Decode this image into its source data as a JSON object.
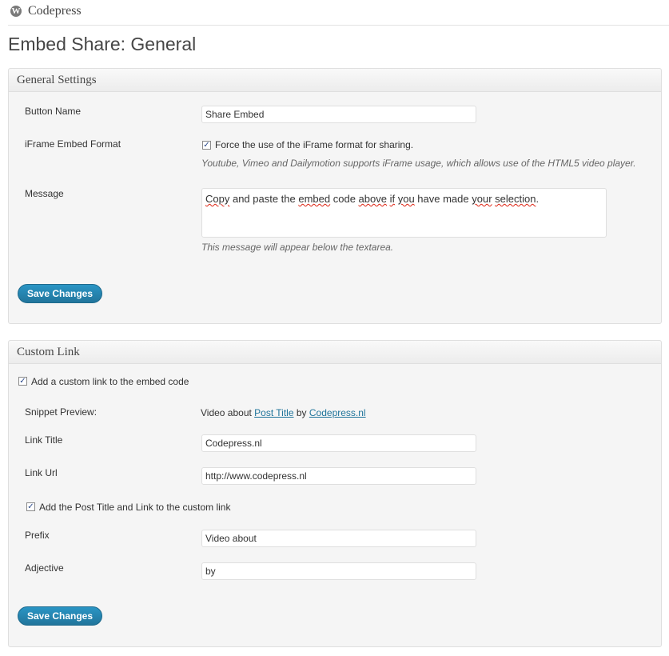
{
  "site": {
    "name": "Codepress",
    "logo_letter": "W"
  },
  "page": {
    "title": "Embed Share: General"
  },
  "general_settings": {
    "title": "General Settings",
    "button_name_label": "Button Name",
    "button_name_value": "Share Embed",
    "iframe_label": "iFrame Embed Format",
    "iframe_checkbox_label": "Force the use of the iFrame format for sharing.",
    "iframe_checked": true,
    "iframe_description": "Youtube, Vimeo and Dailymotion supports iFrame usage, which allows use of the HTML5 video player.",
    "message_label": "Message",
    "message_value_parts": [
      "Copy",
      " and paste the ",
      "embed",
      " code ",
      "above",
      " ",
      "if",
      " ",
      "you",
      " have made ",
      "your",
      " ",
      "selection",
      "."
    ],
    "message_description": "This message will appear below the textarea.",
    "save_label": "Save Changes"
  },
  "custom_link": {
    "title": "Custom Link",
    "add_link_label": "Add a custom link to the embed code",
    "add_link_checked": true,
    "snippet_label": "Snippet Preview:",
    "snippet_prefix": "Video about ",
    "snippet_post_title": "Post Title",
    "snippet_by": " by ",
    "snippet_site": "Codepress.nl",
    "link_title_label": "Link Title",
    "link_title_value": "Codepress.nl",
    "link_url_label": "Link Url",
    "link_url_value": "http://www.codepress.nl",
    "add_post_title_label": "Add the Post Title and Link to the custom link",
    "add_post_title_checked": true,
    "prefix_label": "Prefix",
    "prefix_value": "Video about",
    "adjective_label": "Adjective",
    "adjective_value": "by",
    "save_label": "Save Changes"
  },
  "icons": {
    "check": "✓"
  }
}
